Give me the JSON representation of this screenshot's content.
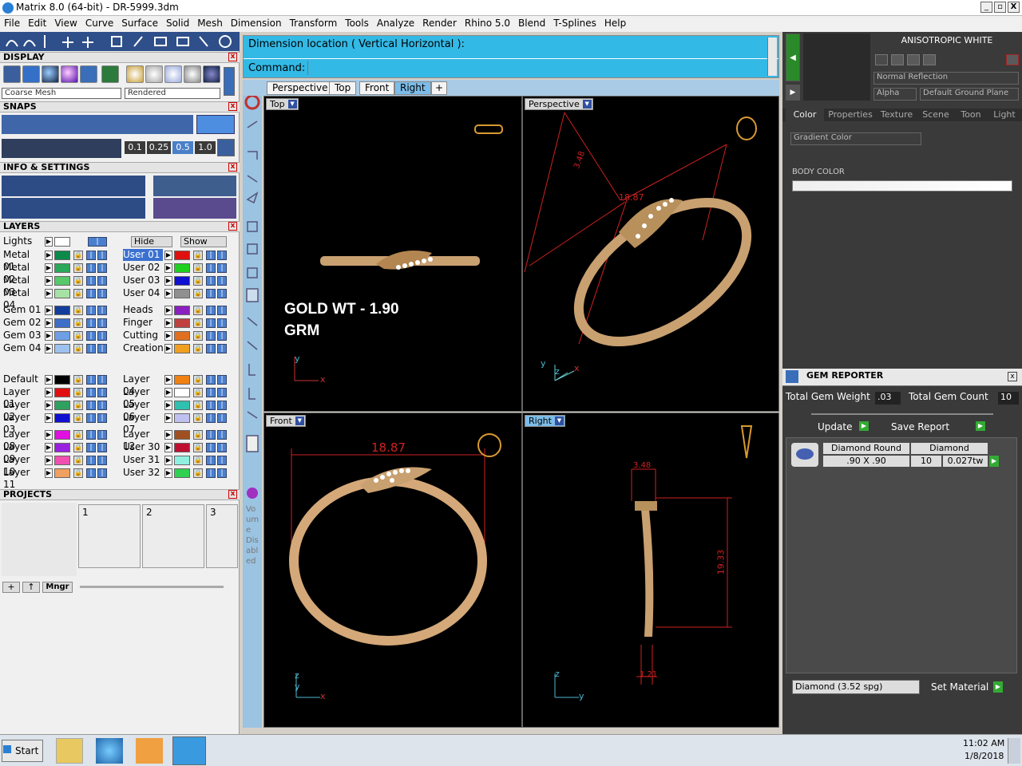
{
  "window": {
    "title": "Matrix 8.0 (64-bit) - DR-5999.3dm",
    "min": "_",
    "max": "▫",
    "close": "X"
  },
  "menu": [
    "File",
    "Edit",
    "View",
    "Curve",
    "Surface",
    "Solid",
    "Mesh",
    "Dimension",
    "Transform",
    "Tools",
    "Analyze",
    "Render",
    "Rhino 5.0",
    "Blend",
    "T-Splines",
    "Help"
  ],
  "left": {
    "display_title": "DISPLAY",
    "mesh_select": "Coarse Mesh",
    "render_select": "Rendered",
    "snaps_title": "SNAPS",
    "snap_values": [
      "0.1",
      "0.25",
      "0.5",
      "1.0"
    ],
    "info_title": "INFO & SETTINGS",
    "layers_title": "LAYERS",
    "lights_label": "Lights",
    "hide_label": "Hide",
    "show_label": "Show",
    "layers_left": [
      {
        "name": "Metal 01",
        "color": "#0b8a4a"
      },
      {
        "name": "Metal 02",
        "color": "#2ca85a"
      },
      {
        "name": "Metal 03",
        "color": "#58c86a"
      },
      {
        "name": "Metal 04",
        "color": "#a6e2a6"
      },
      {
        "name": "Gem 01",
        "color": "#123d9c"
      },
      {
        "name": "Gem 02",
        "color": "#3d6fc8"
      },
      {
        "name": "Gem 03",
        "color": "#6d9fe6"
      },
      {
        "name": "Gem 04",
        "color": "#9ec2f0"
      },
      {
        "name": "Default",
        "color": "#000000"
      },
      {
        "name": "Layer 01",
        "color": "#e01010"
      },
      {
        "name": "Layer 02",
        "color": "#30a060"
      },
      {
        "name": "Layer 03",
        "color": "#1010d0"
      },
      {
        "name": "Layer 08",
        "color": "#e010e0"
      },
      {
        "name": "Layer 09",
        "color": "#9a20e0"
      },
      {
        "name": "Layer 10",
        "color": "#f050b0"
      },
      {
        "name": "Layer 11",
        "color": "#f0a060"
      }
    ],
    "layers_right": [
      {
        "name": "User 01",
        "color": "#e01010"
      },
      {
        "name": "User 02",
        "color": "#20d020"
      },
      {
        "name": "User 03",
        "color": "#1010d0"
      },
      {
        "name": "User 04",
        "color": "#909090"
      },
      {
        "name": "Heads",
        "color": "#8a20c0"
      },
      {
        "name": "Finger",
        "color": "#c04040"
      },
      {
        "name": "Cutting",
        "color": "#e07020"
      },
      {
        "name": "Creation",
        "color": "#f0a020"
      },
      {
        "name": "Layer 04",
        "color": "#f08010"
      },
      {
        "name": "Layer 05",
        "color": "#ffffff"
      },
      {
        "name": "Layer 06",
        "color": "#30c0b0"
      },
      {
        "name": "Layer 07",
        "color": "#c0c0f0"
      },
      {
        "name": "Layer 12",
        "color": "#a05020"
      },
      {
        "name": "User 30",
        "color": "#c01030"
      },
      {
        "name": "User 31",
        "color": "#90f0e0"
      },
      {
        "name": "User 32",
        "color": "#30d050"
      }
    ],
    "projects_title": "PROJECTS",
    "projects": [
      "1",
      "2",
      "3"
    ],
    "mngr": "Mngr",
    "side_text": "Vo um e Dis abl ed"
  },
  "command": {
    "prompt": "Dimension location ( Vertical  Horizontal ):",
    "label": "Command:"
  },
  "tabs": [
    "Perspective",
    "Top",
    "Front",
    "Right",
    "+"
  ],
  "viewports": {
    "top": {
      "label": "Top",
      "annotation_line1": "GOLD WT - 1.90",
      "annotation_line2": "GRM",
      "axis_a": "y",
      "axis_b": "x"
    },
    "perspective": {
      "label": "Perspective",
      "dim1": "18.87",
      "dim2": "3.48",
      "axis_a": "y",
      "axis_b": "z",
      "axis_c": "x"
    },
    "front": {
      "label": "Front",
      "dim": "18.87",
      "axis_a": "z",
      "axis_b": "y",
      "axis_c": "x"
    },
    "right": {
      "label": "Right",
      "dim_top": "3.48",
      "dim_side": "19.33",
      "dim_bottom": "1.21",
      "axis_a": "z",
      "axis_b": "y"
    }
  },
  "right": {
    "material_title": "ANISOTROPIC WHITE",
    "reflection": "Normal Reflection",
    "alpha": "Alpha",
    "ground": "Default Ground Plane",
    "tabs": [
      "Color",
      "Properties",
      "Texture",
      "Scene",
      "Toon",
      "Light"
    ],
    "gradient": "Gradient Color",
    "body_color": "BODY COLOR",
    "gem_title": "GEM REPORTER",
    "total_weight_label": "Total Gem Weight",
    "total_weight": ".03",
    "total_count_label": "Total Gem Count",
    "total_count": "10",
    "update": "Update",
    "save_report": "Save Report",
    "gem_row": {
      "shape": "Diamond Round",
      "size": ".90 X .90",
      "type": "Diamond",
      "count": "10",
      "weight": "0.027tw"
    },
    "material_select": "Diamond    (3.52 spg)",
    "set_material": "Set Material"
  },
  "taskbar": {
    "start": "Start",
    "time": "11:02 AM",
    "date": "1/8/2018"
  }
}
